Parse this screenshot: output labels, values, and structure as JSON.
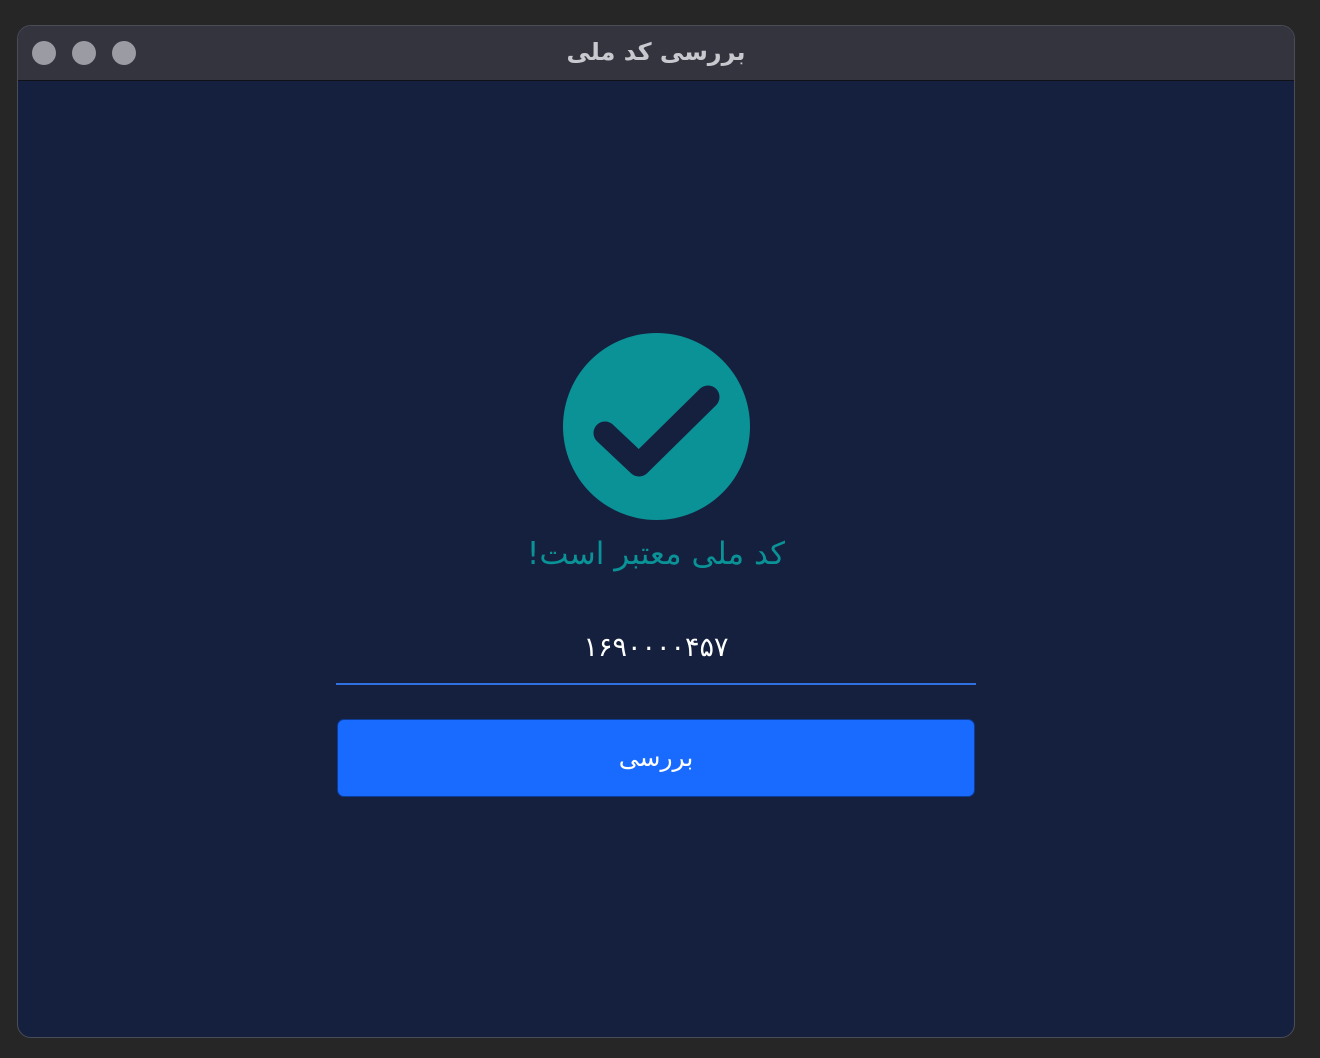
{
  "window": {
    "title": "بررسی کد ملی"
  },
  "status": {
    "icon": "check-circle-icon",
    "message": "کد ملی معتبر است!",
    "color": "#0a9296"
  },
  "input": {
    "value": "۱۶۹۰۰۰۰۴۵۷",
    "placeholder": ""
  },
  "button": {
    "label": "بررسی",
    "color": "#196bff"
  },
  "colors": {
    "background": "#14203e",
    "titlebar": "#33343e",
    "accent": "#196bff",
    "success": "#0a9296"
  }
}
